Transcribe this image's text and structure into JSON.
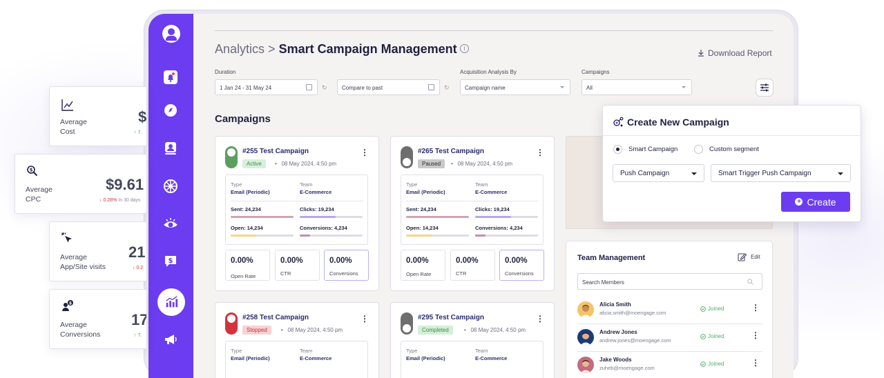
{
  "breadcrumb": {
    "parent": "Analytics",
    "separator": ">",
    "current": "Smart Campaign Management"
  },
  "download_label": "Download Report",
  "filters": {
    "duration": {
      "label": "Duration",
      "value": "1 Jan 24 - 31 May 24"
    },
    "compare": {
      "value": "Compare to past"
    },
    "acquisition": {
      "label": "Acquisition Analysis By",
      "value": "Campaign name"
    },
    "campaigns": {
      "label": "Campaigns",
      "value": "All"
    }
  },
  "campaigns_title": "Campaigns",
  "campaigns": [
    {
      "name": "#255 Test Campaign",
      "status": "Active",
      "date": "08 May 2024, 4:50 pm",
      "type_label": "Type",
      "type": "Email (Periodic)",
      "team_label": "Team",
      "team": "E-Commerce",
      "sent": "Sent: 24,234",
      "clicks": "Clicks: 19,234",
      "open": "Open: 14,234",
      "conversions": "Conversions: 4,234",
      "open_rate": "0.00%",
      "open_rate_label": "Open Rate",
      "ctr": "0.00%",
      "ctr_label": "CTR",
      "conv": "0.00%",
      "conv_label": "Conversions"
    },
    {
      "name": "#265 Test Campaign",
      "status": "Paused",
      "date": "08 May 2024, 4:50 pm",
      "type_label": "Type",
      "type": "Email (Periodic)",
      "team_label": "Team",
      "team": "E-Commerce",
      "sent": "Sent: 24,234",
      "clicks": "Clicks: 19,234",
      "open": "Open: 14,234",
      "conversions": "Conversions: 4,234",
      "open_rate": "0.00%",
      "open_rate_label": "Open Rate",
      "ctr": "0.00%",
      "ctr_label": "CTR",
      "conv": "0.00%",
      "conv_label": "Conversions"
    },
    {
      "name": "#258 Test Campaign",
      "status": "Stopped",
      "date": "08 May 2024, 4:50 pm",
      "type_label": "Type",
      "type": "Email (Periodic)",
      "team_label": "Team",
      "team": "E-Commerce"
    },
    {
      "name": "#295 Test Campaign",
      "status": "Completed",
      "date": "08 May 2024, 4:50 pm",
      "type_label": "Type",
      "type": "Email (Periodic)",
      "team_label": "Team",
      "team": "E-Commerce"
    }
  ],
  "team": {
    "title": "Team Management",
    "edit_label": "Edit",
    "search_placeholder": "Search Members",
    "members": [
      {
        "name": "Alicia Smith",
        "email": "alicia.smith@moengage.com",
        "status": "Joined"
      },
      {
        "name": "Andrew Jones",
        "email": "andrew.jones@moengage.com",
        "status": "Joined"
      },
      {
        "name": "Jake Woods",
        "email": "zuheb@moengage.com",
        "status": "Joined"
      }
    ]
  },
  "stats": [
    {
      "label_line1": "Average",
      "label_line2": "Cost",
      "value": "$",
      "trend": "↑ 7."
    },
    {
      "label_line1": "Average",
      "label_line2": "CPC",
      "value": "$9.61",
      "trend": "↓ 0.28%",
      "trend_suffix": "In 30 days"
    },
    {
      "label_line1": "Average",
      "label_line2": "App/Site visits",
      "value": "21",
      "trend": "↓ 0.2"
    },
    {
      "label_line1": "Average",
      "label_line2": "Conversions",
      "value": "17",
      "trend": "↑ 7."
    }
  ],
  "modal": {
    "title": "Create New Campaign",
    "radio_smart": "Smart Campaign",
    "radio_custom": "Custom segment",
    "select_type": "Push Campaign",
    "select_trigger": "Smart Trigger Push Campaign",
    "create_label": "Create"
  },
  "colors": {
    "accent": "#6b3cf0",
    "active": "#5a9e62",
    "paused": "#6e6e6e",
    "stopped": "#d6323d",
    "completed": "#6e6e6e",
    "sent_bar": "#cfa3b6",
    "clicks_bar": "#b7a6ee",
    "open_bar": "#f3d58a",
    "conv_bar": "#c98ba9"
  }
}
